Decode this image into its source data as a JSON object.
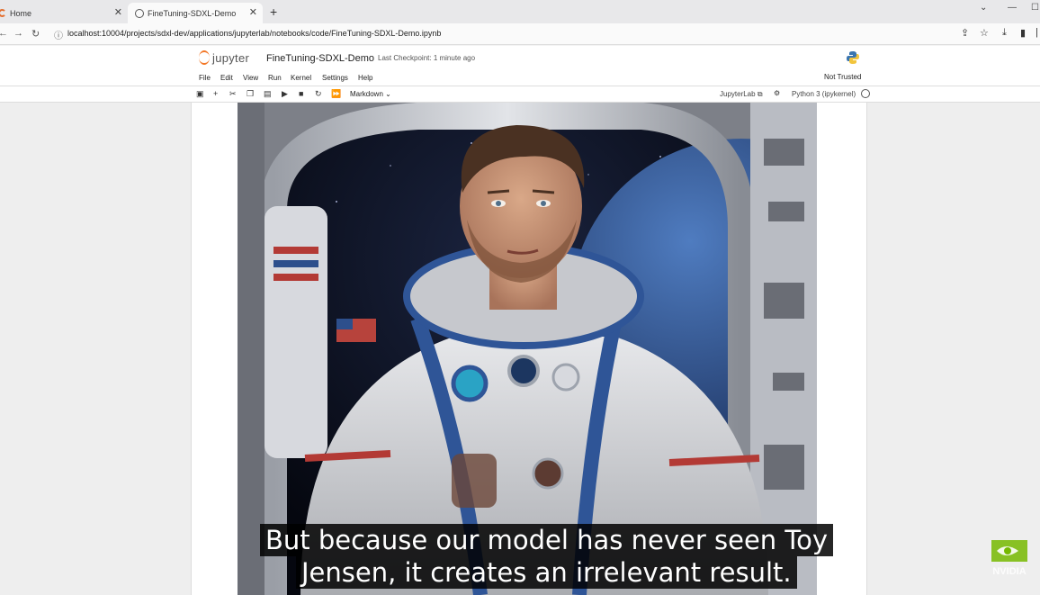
{
  "browser": {
    "tabs": [
      {
        "title": "Home",
        "active": false
      },
      {
        "title": "FineTuning-SDXL-Demo",
        "active": true
      }
    ],
    "url": "localhost:10004/projects/sdxl-dev/applications/jupyterlab/notebooks/code/FineTuning-SDXL-Demo.ipynb"
  },
  "jupyter": {
    "wordmark": "jupyter",
    "notebook_title": "FineTuning-SDXL-Demo",
    "checkpoint": "Last Checkpoint: 1 minute ago",
    "trust_status": "Not Trusted",
    "menu": [
      "File",
      "Edit",
      "View",
      "Run",
      "Kernel",
      "Settings",
      "Help"
    ],
    "cell_type": "Markdown",
    "jupyterlab_link": "JupyterLab",
    "kernel": "Python 3 (ipykernel)"
  },
  "subtitles": {
    "line1": "But because our model has never seen Toy",
    "line2": "Jensen, it creates an irrelevant result."
  },
  "watermark": {
    "brand": "NVIDIA"
  },
  "colors": {
    "jupyter_orange": "#f37726",
    "nvidia_green": "#76b900"
  }
}
